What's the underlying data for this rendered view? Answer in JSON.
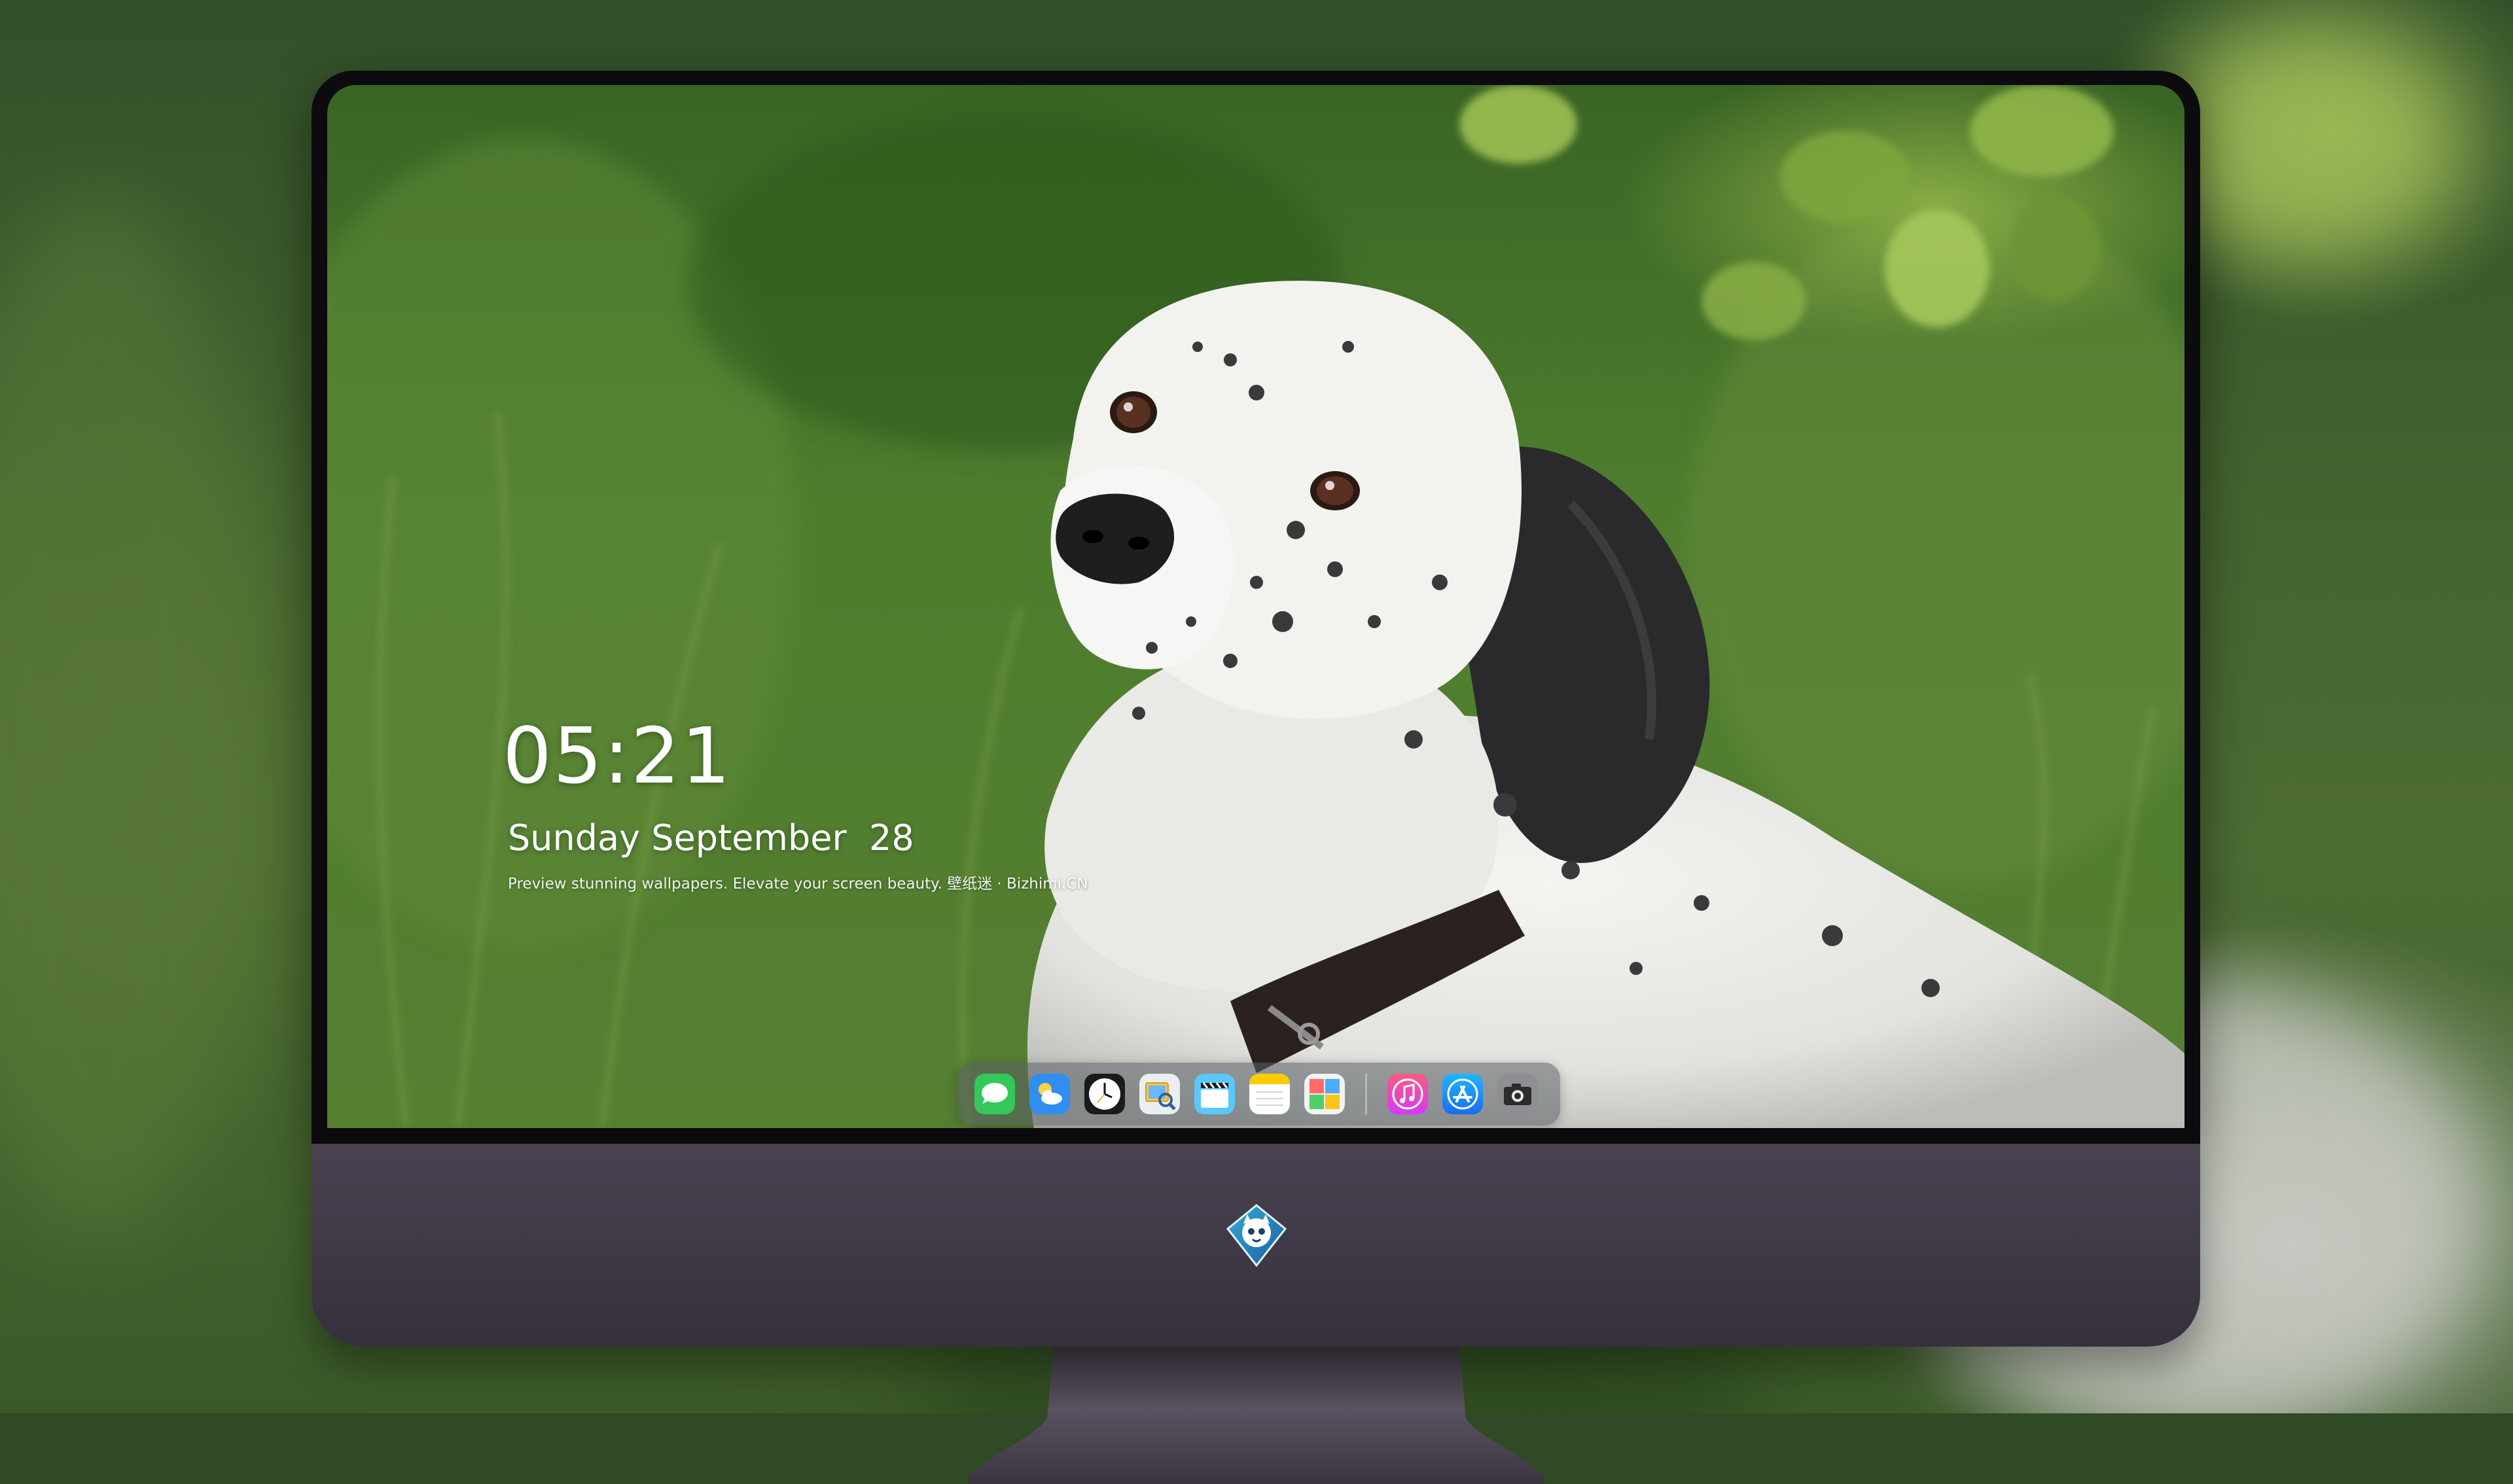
{
  "lockscreen": {
    "time": "05:21",
    "date": "Sunday September  28",
    "tagline": "Preview stunning wallpapers. Elevate your screen beauty. 壁纸迷 · Bizhimi.CN"
  },
  "dock": {
    "apps": [
      {
        "name": "messages-icon"
      },
      {
        "name": "weather-icon"
      },
      {
        "name": "clock-icon"
      },
      {
        "name": "preview-icon"
      },
      {
        "name": "clips-icon"
      },
      {
        "name": "notes-icon"
      },
      {
        "name": "photo-booth-icon"
      },
      {
        "name": "music-icon"
      },
      {
        "name": "app-store-icon"
      },
      {
        "name": "camera-icon"
      }
    ]
  },
  "colors": {
    "accent_green": "#4f7a30",
    "dock_bg": "#5a5f64",
    "chin": "#3f3946"
  }
}
